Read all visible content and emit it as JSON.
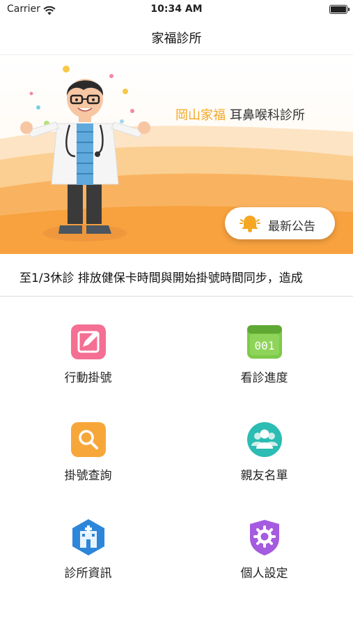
{
  "status": {
    "carrier": "Carrier",
    "time": "10:34 AM"
  },
  "nav": {
    "title": "家福診所"
  },
  "banner": {
    "location": "岡山家福",
    "department": "耳鼻喉科診所",
    "announce_label": "最新公告"
  },
  "marquee": {
    "text": "至1/3休診 排放健保卡時間與開始掛號時間同步，造成"
  },
  "menu": [
    {
      "label": "行動掛號",
      "icon": "edit-note-icon"
    },
    {
      "label": "看診進度",
      "icon": "counter-display-icon",
      "counter": "001"
    },
    {
      "label": "掛號查詢",
      "icon": "search-icon"
    },
    {
      "label": "親友名單",
      "icon": "people-icon"
    },
    {
      "label": "診所資訊",
      "icon": "hospital-icon"
    },
    {
      "label": "個人設定",
      "icon": "gear-shield-icon"
    }
  ],
  "colors": {
    "accent": "#f5a623",
    "pink": "#f46f93",
    "green": "#7ec94a",
    "orange": "#f7a73a",
    "teal": "#2bbcb3",
    "blue": "#2d86d9",
    "purple": "#a55be0"
  }
}
